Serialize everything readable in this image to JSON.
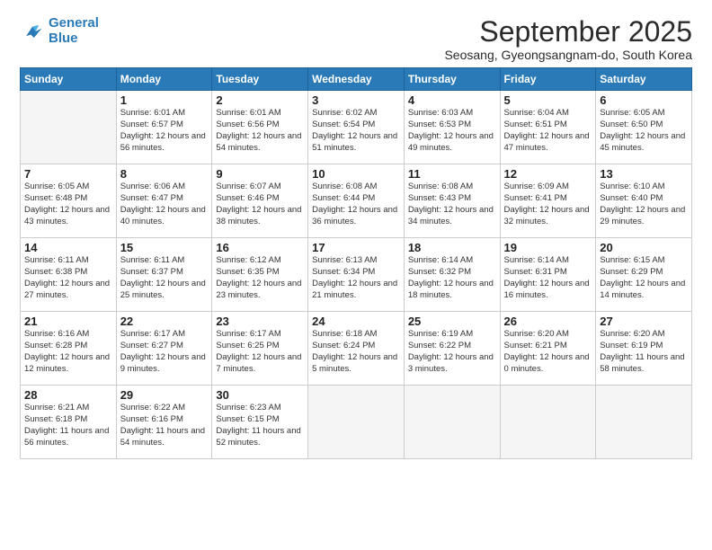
{
  "logo": {
    "line1": "General",
    "line2": "Blue"
  },
  "title": "September 2025",
  "location": "Seosang, Gyeongsangnam-do, South Korea",
  "weekdays": [
    "Sunday",
    "Monday",
    "Tuesday",
    "Wednesday",
    "Thursday",
    "Friday",
    "Saturday"
  ],
  "days": [
    {
      "num": "",
      "info": ""
    },
    {
      "num": "1",
      "info": "Sunrise: 6:01 AM\nSunset: 6:57 PM\nDaylight: 12 hours\nand 56 minutes."
    },
    {
      "num": "2",
      "info": "Sunrise: 6:01 AM\nSunset: 6:56 PM\nDaylight: 12 hours\nand 54 minutes."
    },
    {
      "num": "3",
      "info": "Sunrise: 6:02 AM\nSunset: 6:54 PM\nDaylight: 12 hours\nand 51 minutes."
    },
    {
      "num": "4",
      "info": "Sunrise: 6:03 AM\nSunset: 6:53 PM\nDaylight: 12 hours\nand 49 minutes."
    },
    {
      "num": "5",
      "info": "Sunrise: 6:04 AM\nSunset: 6:51 PM\nDaylight: 12 hours\nand 47 minutes."
    },
    {
      "num": "6",
      "info": "Sunrise: 6:05 AM\nSunset: 6:50 PM\nDaylight: 12 hours\nand 45 minutes."
    },
    {
      "num": "7",
      "info": "Sunrise: 6:05 AM\nSunset: 6:48 PM\nDaylight: 12 hours\nand 43 minutes."
    },
    {
      "num": "8",
      "info": "Sunrise: 6:06 AM\nSunset: 6:47 PM\nDaylight: 12 hours\nand 40 minutes."
    },
    {
      "num": "9",
      "info": "Sunrise: 6:07 AM\nSunset: 6:46 PM\nDaylight: 12 hours\nand 38 minutes."
    },
    {
      "num": "10",
      "info": "Sunrise: 6:08 AM\nSunset: 6:44 PM\nDaylight: 12 hours\nand 36 minutes."
    },
    {
      "num": "11",
      "info": "Sunrise: 6:08 AM\nSunset: 6:43 PM\nDaylight: 12 hours\nand 34 minutes."
    },
    {
      "num": "12",
      "info": "Sunrise: 6:09 AM\nSunset: 6:41 PM\nDaylight: 12 hours\nand 32 minutes."
    },
    {
      "num": "13",
      "info": "Sunrise: 6:10 AM\nSunset: 6:40 PM\nDaylight: 12 hours\nand 29 minutes."
    },
    {
      "num": "14",
      "info": "Sunrise: 6:11 AM\nSunset: 6:38 PM\nDaylight: 12 hours\nand 27 minutes."
    },
    {
      "num": "15",
      "info": "Sunrise: 6:11 AM\nSunset: 6:37 PM\nDaylight: 12 hours\nand 25 minutes."
    },
    {
      "num": "16",
      "info": "Sunrise: 6:12 AM\nSunset: 6:35 PM\nDaylight: 12 hours\nand 23 minutes."
    },
    {
      "num": "17",
      "info": "Sunrise: 6:13 AM\nSunset: 6:34 PM\nDaylight: 12 hours\nand 21 minutes."
    },
    {
      "num": "18",
      "info": "Sunrise: 6:14 AM\nSunset: 6:32 PM\nDaylight: 12 hours\nand 18 minutes."
    },
    {
      "num": "19",
      "info": "Sunrise: 6:14 AM\nSunset: 6:31 PM\nDaylight: 12 hours\nand 16 minutes."
    },
    {
      "num": "20",
      "info": "Sunrise: 6:15 AM\nSunset: 6:29 PM\nDaylight: 12 hours\nand 14 minutes."
    },
    {
      "num": "21",
      "info": "Sunrise: 6:16 AM\nSunset: 6:28 PM\nDaylight: 12 hours\nand 12 minutes."
    },
    {
      "num": "22",
      "info": "Sunrise: 6:17 AM\nSunset: 6:27 PM\nDaylight: 12 hours\nand 9 minutes."
    },
    {
      "num": "23",
      "info": "Sunrise: 6:17 AM\nSunset: 6:25 PM\nDaylight: 12 hours\nand 7 minutes."
    },
    {
      "num": "24",
      "info": "Sunrise: 6:18 AM\nSunset: 6:24 PM\nDaylight: 12 hours\nand 5 minutes."
    },
    {
      "num": "25",
      "info": "Sunrise: 6:19 AM\nSunset: 6:22 PM\nDaylight: 12 hours\nand 3 minutes."
    },
    {
      "num": "26",
      "info": "Sunrise: 6:20 AM\nSunset: 6:21 PM\nDaylight: 12 hours\nand 0 minutes."
    },
    {
      "num": "27",
      "info": "Sunrise: 6:20 AM\nSunset: 6:19 PM\nDaylight: 11 hours\nand 58 minutes."
    },
    {
      "num": "28",
      "info": "Sunrise: 6:21 AM\nSunset: 6:18 PM\nDaylight: 11 hours\nand 56 minutes."
    },
    {
      "num": "29",
      "info": "Sunrise: 6:22 AM\nSunset: 6:16 PM\nDaylight: 11 hours\nand 54 minutes."
    },
    {
      "num": "30",
      "info": "Sunrise: 6:23 AM\nSunset: 6:15 PM\nDaylight: 11 hours\nand 52 minutes."
    },
    {
      "num": "",
      "info": ""
    },
    {
      "num": "",
      "info": ""
    },
    {
      "num": "",
      "info": ""
    },
    {
      "num": "",
      "info": ""
    }
  ]
}
